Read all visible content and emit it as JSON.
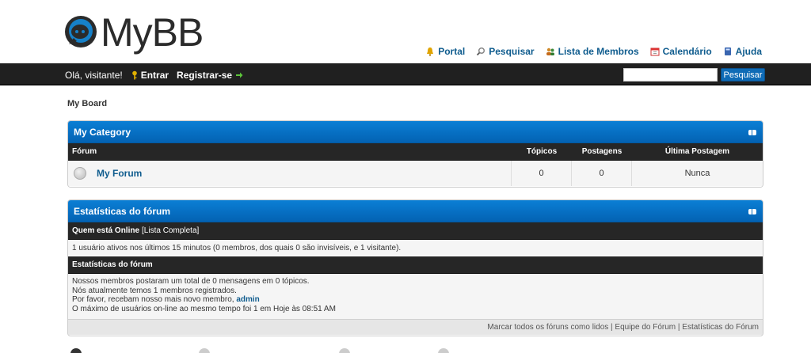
{
  "header": {
    "logo_text": "MyBB",
    "links": [
      {
        "label": "Portal",
        "icon": "bell-icon"
      },
      {
        "label": "Pesquisar",
        "icon": "magnifier-icon"
      },
      {
        "label": "Lista de Membros",
        "icon": "members-icon"
      },
      {
        "label": "Calendário",
        "icon": "calendar-icon"
      },
      {
        "label": "Ajuda",
        "icon": "help-book-icon"
      }
    ]
  },
  "panel": {
    "welcome": "Olá, visitante!",
    "login": "Entrar",
    "register": "Registrar-se",
    "search_placeholder": "",
    "search_button": "Pesquisar"
  },
  "breadcrumb": "My Board",
  "category": {
    "title": "My Category",
    "columns": [
      "Fórum",
      "Tópicos",
      "Postagens",
      "Última Postagem"
    ],
    "forums": [
      {
        "name": "My Forum",
        "topics": "0",
        "posts": "0",
        "last_post": "Nunca"
      }
    ]
  },
  "stats": {
    "title": "Estatísticas do fórum",
    "online_header": "Quem está Online",
    "online_link": "[Lista Completa]",
    "online_text": "1 usuário ativos nos últimos 15 minutos (0 membros, dos quais 0 são invisíveis, e 1 visitante).",
    "stats_header": "Estatísticas do fórum",
    "line1": "Nossos membros postaram um total de 0 mensagens em 0 tópicos.",
    "line2": "Nós atualmente temos 1 membros registrados.",
    "line3_prefix": "Por favor, recebam nosso mais novo membro,",
    "newest_member": "admin",
    "line4": "O máximo de usuários on-line ao mesmo tempo foi 1 em Hoje às 08:51 AM",
    "bottom_links": [
      "Marcar todos os fóruns como lidos",
      "Equipe do Fórum",
      "Estatísticas do Fórum"
    ]
  },
  "colors": {
    "accent": "#0f6bb6",
    "link": "#0f5c8e",
    "dark_bar": "#202020"
  }
}
